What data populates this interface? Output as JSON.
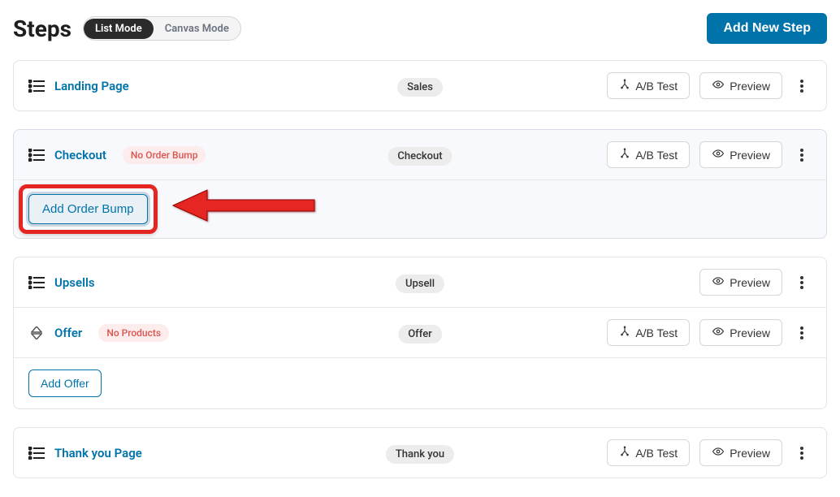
{
  "header": {
    "title": "Steps",
    "modes": {
      "list": "List Mode",
      "canvas": "Canvas Mode"
    },
    "add_button": "Add New Step"
  },
  "buttons": {
    "ab_test": "A/B Test",
    "preview": "Preview",
    "add_order_bump": "Add Order Bump",
    "add_offer": "Add Offer"
  },
  "steps": {
    "landing": {
      "name": "Landing Page",
      "tag": "Sales"
    },
    "checkout": {
      "name": "Checkout",
      "warn": "No Order Bump",
      "tag": "Checkout"
    },
    "upsells": {
      "name": "Upsells",
      "tag": "Upsell"
    },
    "offer": {
      "name": "Offer",
      "warn": "No Products",
      "tag": "Offer"
    },
    "thankyou": {
      "name": "Thank you Page",
      "tag": "Thank you"
    }
  }
}
